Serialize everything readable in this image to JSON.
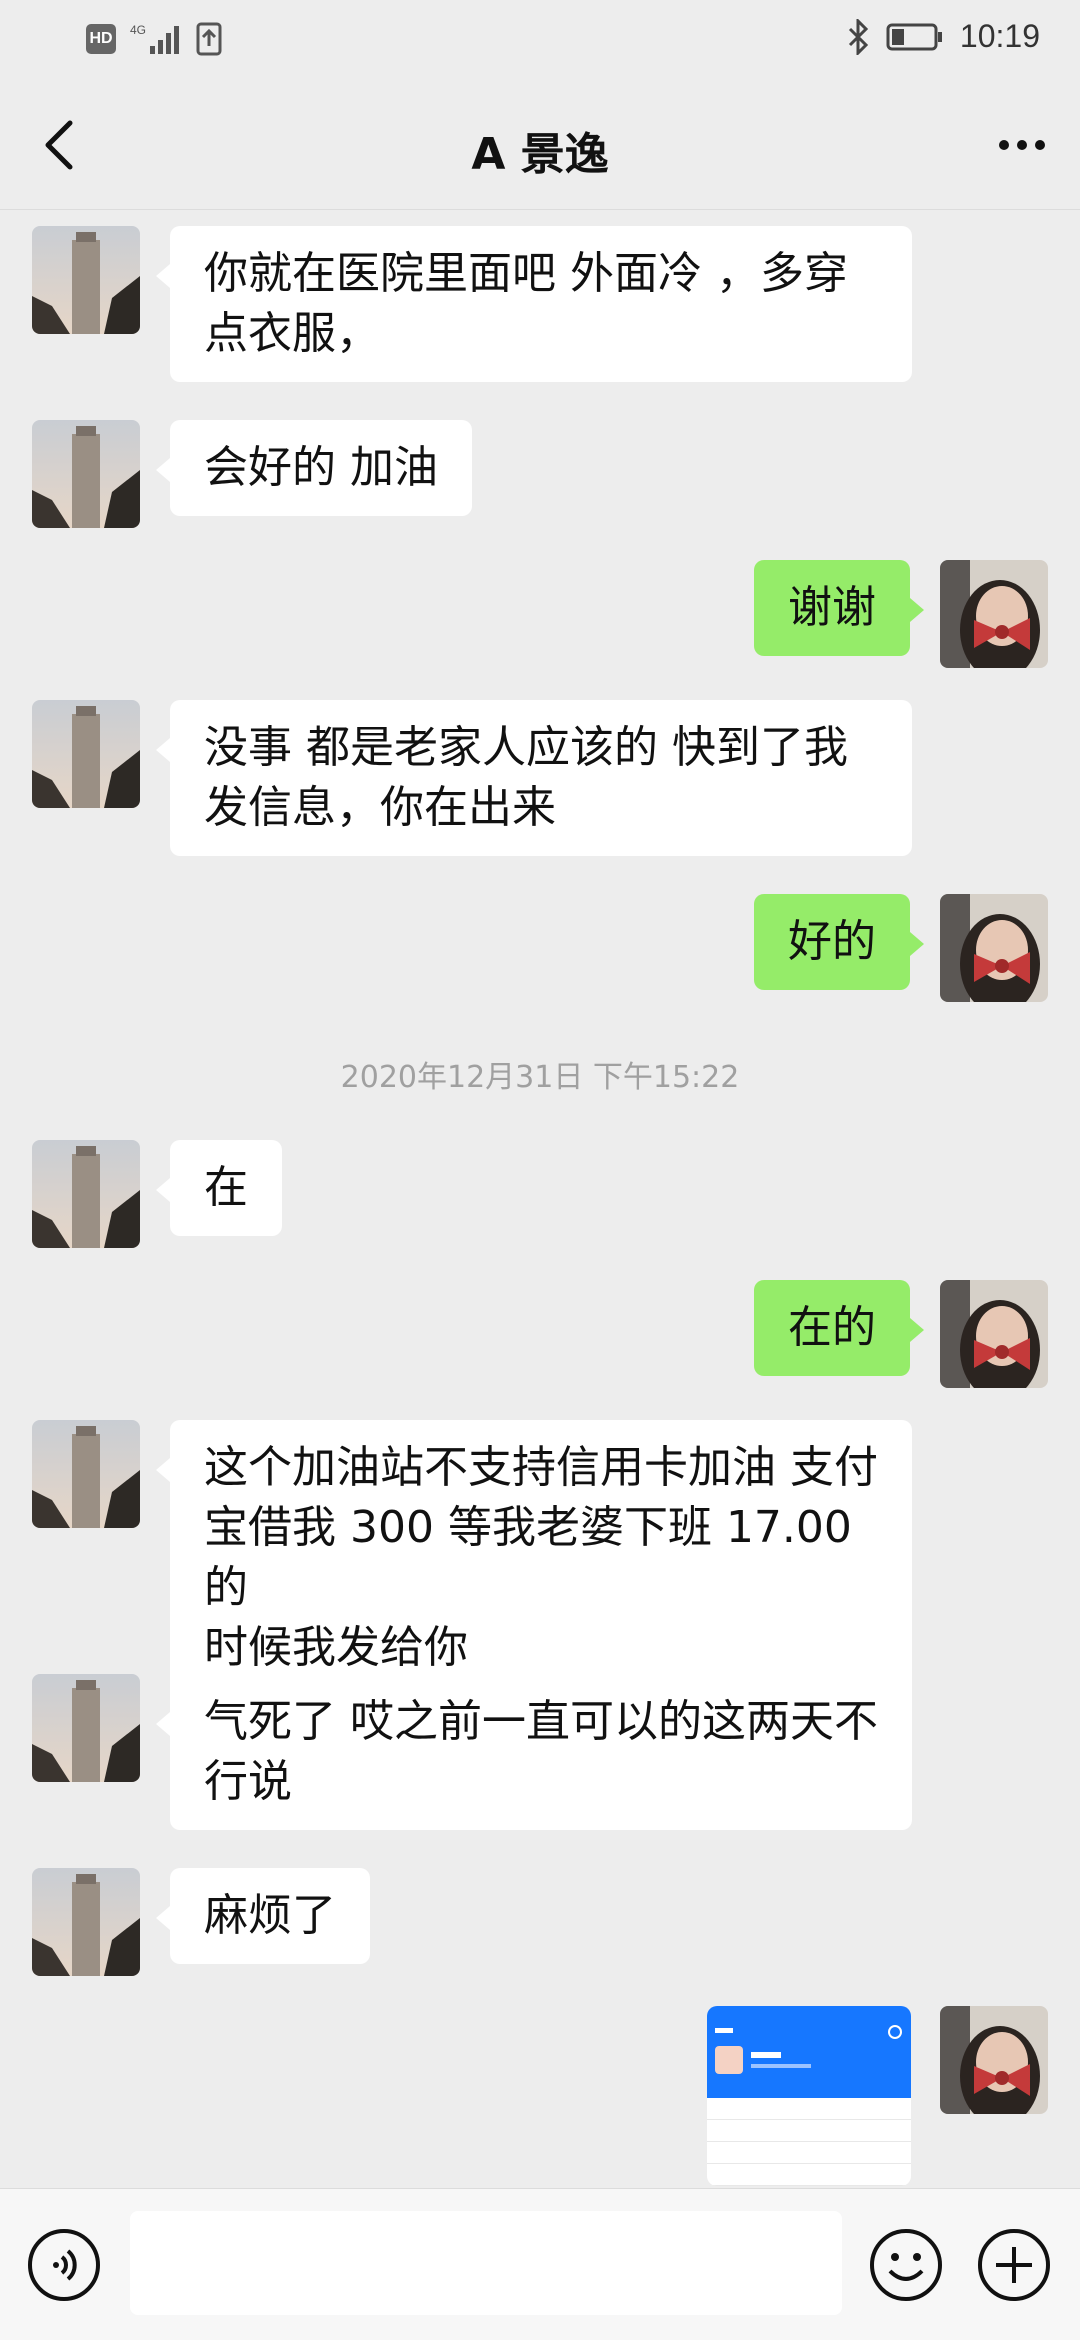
{
  "status_bar": {
    "network": "4G",
    "hd": "HD",
    "time": "10:19"
  },
  "header": {
    "title": "A 景逸"
  },
  "messages": [
    {
      "side": "in",
      "text_lines": [
        "你就在医院里面吧 外面冷 ，多穿",
        "点衣服，"
      ]
    },
    {
      "side": "in",
      "text_lines": [
        "会好的 加油"
      ]
    },
    {
      "side": "out",
      "text_lines": [
        "谢谢"
      ]
    },
    {
      "side": "in",
      "text_lines": [
        "没事 都是老家人应该的 快到了我",
        "发信息，你在出来"
      ]
    },
    {
      "side": "out",
      "text_lines": [
        "好的"
      ]
    },
    {
      "side": "in",
      "text_lines": [
        "在"
      ]
    },
    {
      "side": "out",
      "text_lines": [
        "在的"
      ]
    },
    {
      "side": "in",
      "text_lines": [
        "这个加油站不支持信用卡加油 支付",
        "宝借我 300 等我老婆下班 17.00 的",
        "时候我发给你"
      ]
    },
    {
      "side": "in",
      "text_lines": [
        "气死了 哎之前一直可以的这两天不",
        "行说"
      ]
    },
    {
      "side": "in",
      "text_lines": [
        "麻烦了"
      ]
    }
  ],
  "timestamp": "2020年12月31日 下午15:22",
  "image_message": {
    "type": "screenshot",
    "app_color": "#1677ff"
  },
  "input": {
    "placeholder": ""
  },
  "colors": {
    "background": "#ededed",
    "out_bubble": "#95ec69",
    "in_bubble": "#ffffff"
  }
}
